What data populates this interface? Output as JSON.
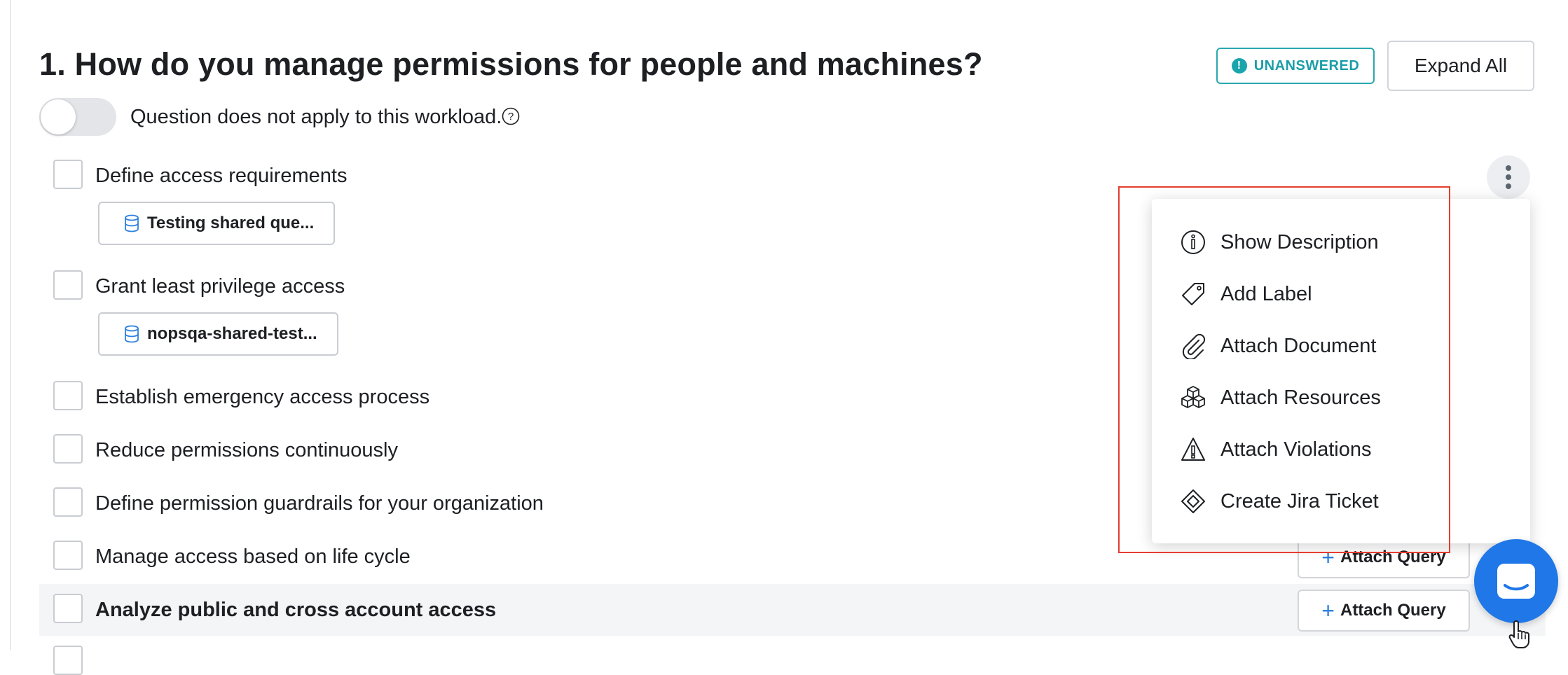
{
  "question": {
    "title": "1. How do you manage permissions for people and machines?",
    "status": "UNANSWERED",
    "status_icon": "!",
    "expand_all_label": "Expand All",
    "not_applicable_label": "Question does not apply to this workload.",
    "help_icon": "?"
  },
  "items": [
    {
      "label": "Define access requirements",
      "chip": "Testing shared que..."
    },
    {
      "label": "Grant least privilege access",
      "chip": "nopsqa-shared-test..."
    },
    {
      "label": "Establish emergency access process"
    },
    {
      "label": "Reduce permissions continuously"
    },
    {
      "label": "Define permission guardrails for your organization"
    },
    {
      "label": "Manage access based on life cycle",
      "action": "Attach Query"
    },
    {
      "label": "Analyze public and cross account access",
      "action": "Attach Query"
    }
  ],
  "menu": {
    "items": [
      {
        "label": "Show Description",
        "icon": "info-icon"
      },
      {
        "label": "Add Label",
        "icon": "tag-icon"
      },
      {
        "label": "Attach Document",
        "icon": "paperclip-icon"
      },
      {
        "label": "Attach Resources",
        "icon": "cubes-icon"
      },
      {
        "label": "Attach Violations",
        "icon": "warning-icon"
      },
      {
        "label": "Create Jira Ticket",
        "icon": "jira-icon"
      }
    ]
  },
  "colors": {
    "badge": "#1a9ea8",
    "accent": "#2d7fe0",
    "highlight_box": "#e53d2f",
    "chat_button": "#1f77e8"
  }
}
